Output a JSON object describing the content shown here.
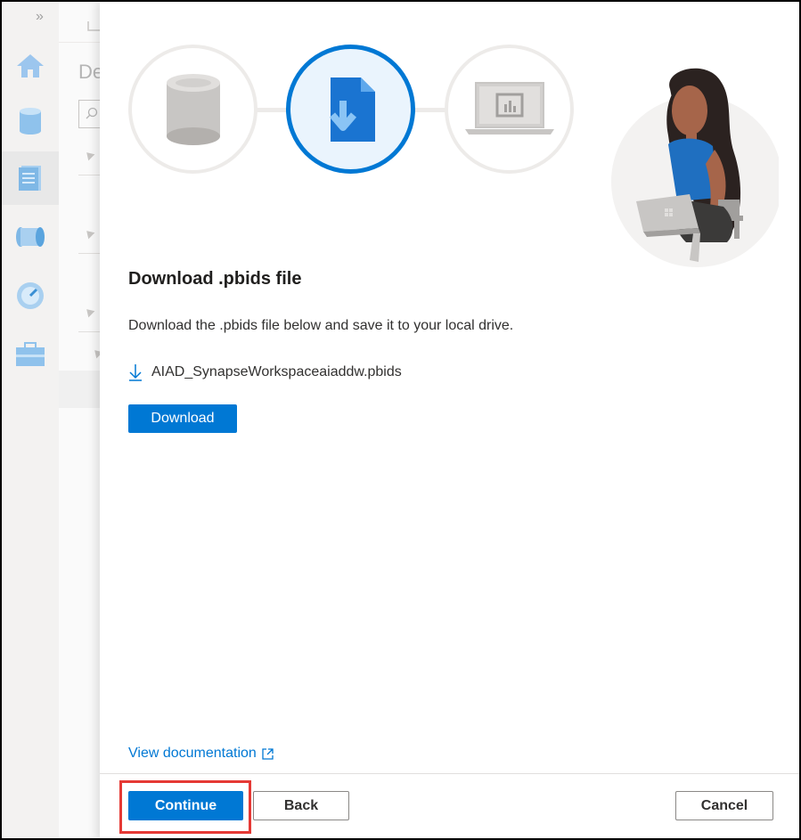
{
  "background": {
    "rail_icons": [
      "home-icon",
      "database-icon",
      "document-icon",
      "pipeline-icon",
      "monitor-icon",
      "manage-toolbox-icon"
    ],
    "partial_title": "De"
  },
  "dialog": {
    "steps": [
      {
        "name": "database-icon",
        "state": "done"
      },
      {
        "name": "pbids-file-download-icon",
        "state": "active"
      },
      {
        "name": "power-bi-laptop-icon",
        "state": "upcoming"
      }
    ],
    "heading": "Download .pbids file",
    "description": "Download the .pbids file below and save it to your local drive.",
    "file_name": "AIAD_SynapseWorkspaceaiaddw.pbids",
    "download_label": "Download",
    "doc_link": "View documentation",
    "continue_label": "Continue",
    "back_label": "Back",
    "cancel_label": "Cancel"
  },
  "colors": {
    "accent": "#0078d4",
    "highlight": "#e53935"
  }
}
